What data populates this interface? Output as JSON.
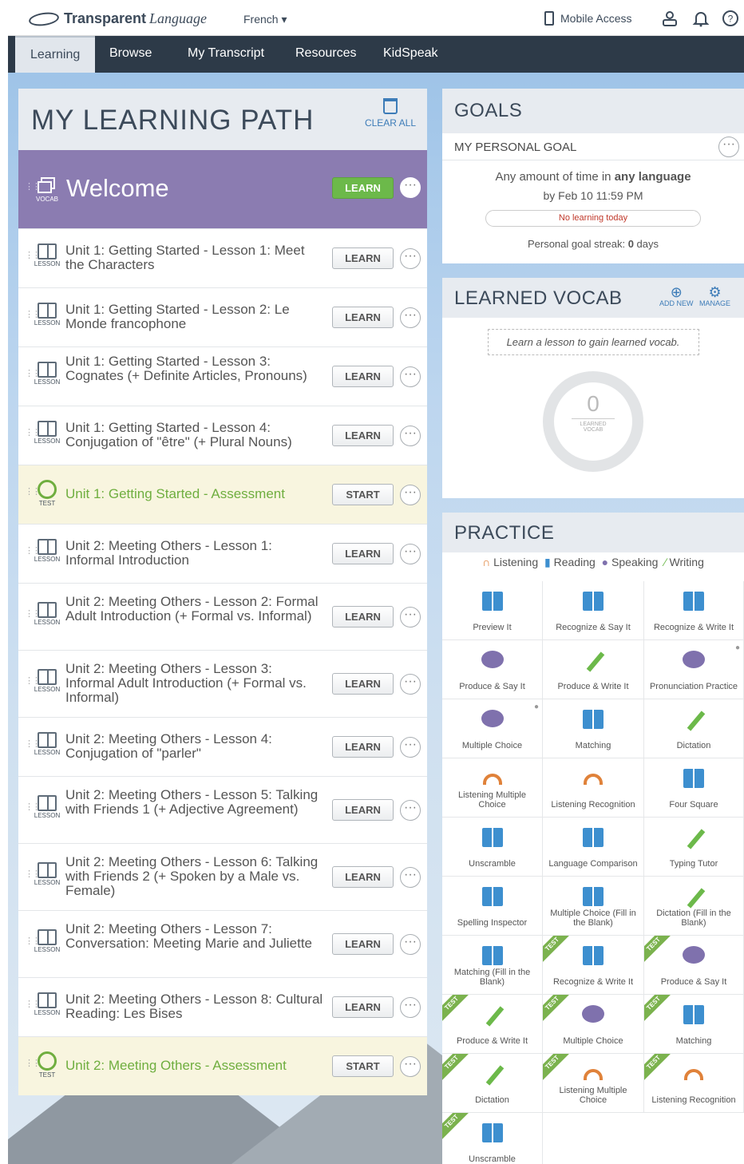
{
  "brand": {
    "bold": "Transparent",
    "italic": "Language"
  },
  "language_select": "French",
  "mobile_access": "Mobile Access",
  "nav": {
    "tabs": [
      "Learning",
      "Browse",
      "My Transcript",
      "Resources",
      "KidSpeak"
    ]
  },
  "learning_path": {
    "title": "MY LEARNING PATH",
    "clear_all": "CLEAR ALL",
    "welcome": {
      "title": "Welcome",
      "type": "VOCAB",
      "button": "LEARN"
    },
    "items": [
      {
        "title": "Unit 1: Getting Started - Lesson 1: Meet the Characters",
        "type": "LESSON",
        "button": "LEARN"
      },
      {
        "title": "Unit 1: Getting Started - Lesson 2: Le Monde francophone",
        "type": "LESSON",
        "button": "LEARN"
      },
      {
        "title": "Unit 1: Getting Started - Lesson 3: Cognates (+ Definite Articles, Pronouns)",
        "type": "LESSON",
        "button": "LEARN"
      },
      {
        "title": "Unit 1: Getting Started - Lesson 4: Conjugation of \"être\" (+ Plural Nouns)",
        "type": "LESSON",
        "button": "LEARN"
      },
      {
        "title": "Unit 1: Getting Started - Assessment",
        "type": "TEST",
        "button": "START"
      },
      {
        "title": "Unit 2: Meeting Others - Lesson 1: Informal Introduction",
        "type": "LESSON",
        "button": "LEARN"
      },
      {
        "title": "Unit 2: Meeting Others - Lesson 2: Formal Adult Introduction (+ Formal vs. Informal)",
        "type": "LESSON",
        "button": "LEARN"
      },
      {
        "title": "Unit 2: Meeting Others - Lesson 3: Informal Adult Introduction (+ Formal vs. Informal)",
        "type": "LESSON",
        "button": "LEARN"
      },
      {
        "title": "Unit 2: Meeting Others - Lesson 4: Conjugation of \"parler\"",
        "type": "LESSON",
        "button": "LEARN"
      },
      {
        "title": "Unit 2: Meeting Others - Lesson 5: Talking with Friends 1 (+ Adjective Agreement)",
        "type": "LESSON",
        "button": "LEARN"
      },
      {
        "title": "Unit 2: Meeting Others - Lesson 6: Talking with Friends 2 (+ Spoken by a Male vs. Female)",
        "type": "LESSON",
        "button": "LEARN"
      },
      {
        "title": "Unit 2: Meeting Others - Lesson 7: Conversation: Meeting Marie and Juliette",
        "type": "LESSON",
        "button": "LEARN"
      },
      {
        "title": "Unit 2: Meeting Others - Lesson 8: Cultural Reading: Les Bises",
        "type": "LESSON",
        "button": "LEARN"
      },
      {
        "title": "Unit 2: Meeting Others - Assessment",
        "type": "TEST",
        "button": "START"
      }
    ]
  },
  "goals": {
    "title": "GOALS",
    "personal_goal_label": "MY PERSONAL GOAL",
    "amount_prefix": "Any amount of time in ",
    "amount_bold": "any language",
    "deadline": "by Feb 10 11:59 PM",
    "progress_text": "No learning today",
    "streak_prefix": "Personal goal streak: ",
    "streak_bold": "0",
    "streak_suffix": " days"
  },
  "learned_vocab": {
    "title": "LEARNED VOCAB",
    "add_new": "ADD NEW",
    "manage": "MANAGE",
    "note": "Learn a lesson to gain learned vocab.",
    "count": "0",
    "count_label": "LEARNED VOCAB"
  },
  "practice": {
    "title": "PRACTICE",
    "legend": [
      "Listening",
      "Reading",
      "Speaking",
      "Writing"
    ],
    "activities": [
      {
        "label": "Preview It",
        "icon": "book-icon"
      },
      {
        "label": "Recognize & Say It",
        "icon": "book-icon"
      },
      {
        "label": "Recognize & Write It",
        "icon": "book-icon"
      },
      {
        "label": "Produce & Say It",
        "icon": "speech-bubble-icon"
      },
      {
        "label": "Produce & Write It",
        "icon": "pencil-icon"
      },
      {
        "label": "Pronunciation Practice",
        "icon": "speech-bubble-icon",
        "mic": true
      },
      {
        "label": "Multiple Choice",
        "icon": "speech-bubble-icon",
        "mic": true
      },
      {
        "label": "Matching",
        "icon": "book-icon"
      },
      {
        "label": "Dictation",
        "icon": "pencil-icon"
      },
      {
        "label": "Listening Multiple Choice",
        "icon": "headphones-icon"
      },
      {
        "label": "Listening Recognition",
        "icon": "headphones-icon"
      },
      {
        "label": "Four Square",
        "icon": "book-icon"
      },
      {
        "label": "Unscramble",
        "icon": "book-icon"
      },
      {
        "label": "Language Comparison",
        "icon": "book-icon"
      },
      {
        "label": "Typing Tutor",
        "icon": "pencil-icon"
      },
      {
        "label": "Spelling Inspector",
        "icon": "book-icon"
      },
      {
        "label": "Multiple Choice (Fill in the Blank)",
        "icon": "book-icon"
      },
      {
        "label": "Dictation (Fill in the Blank)",
        "icon": "pencil-icon"
      },
      {
        "label": "Matching (Fill in the Blank)",
        "icon": "book-icon"
      },
      {
        "label": "Recognize & Write It",
        "icon": "book-icon",
        "test": true
      },
      {
        "label": "Produce & Say It",
        "icon": "speech-bubble-icon",
        "test": true
      },
      {
        "label": "Produce & Write It",
        "icon": "pencil-icon",
        "test": true
      },
      {
        "label": "Multiple Choice",
        "icon": "speech-bubble-icon",
        "test": true
      },
      {
        "label": "Matching",
        "icon": "book-icon",
        "test": true
      },
      {
        "label": "Dictation",
        "icon": "pencil-icon",
        "test": true
      },
      {
        "label": "Listening Multiple Choice",
        "icon": "headphones-icon",
        "test": true
      },
      {
        "label": "Listening Recognition",
        "icon": "headphones-icon",
        "test": true
      },
      {
        "label": "Unscramble",
        "icon": "book-icon",
        "test": true
      }
    ],
    "test_tag": "TEST"
  },
  "colors": {
    "nav_bg": "#2d3a48",
    "welcome_bg": "#8b7cb1",
    "learn_green": "#6cb94a",
    "test_bg": "#f8f5df",
    "accent_blue": "#3d7cb8"
  }
}
